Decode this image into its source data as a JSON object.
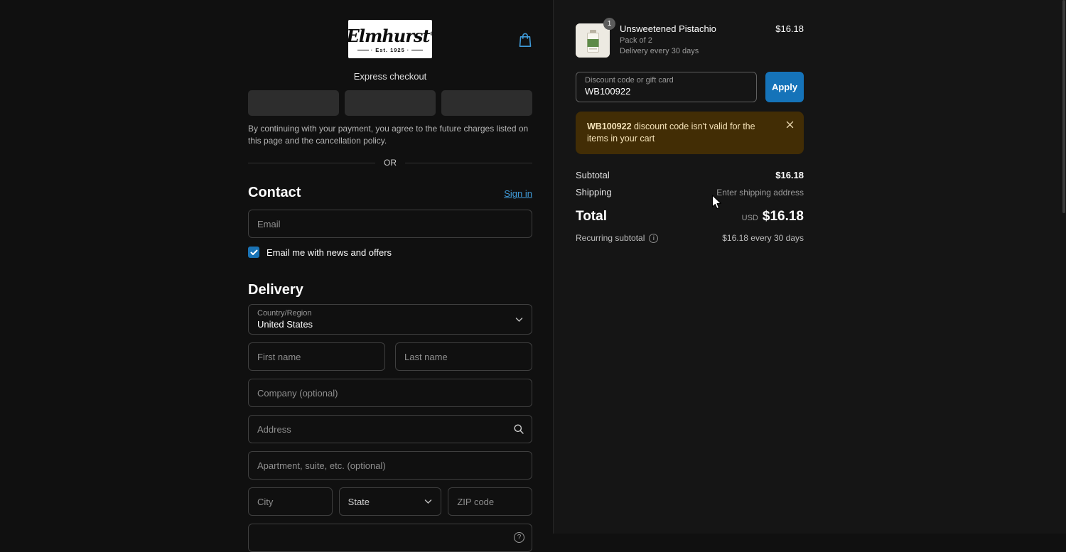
{
  "brand": {
    "name": "Elmhurst",
    "trademark": "®",
    "established": "Est. 1925",
    "dot": "·"
  },
  "express": {
    "title": "Express checkout",
    "disclaimer": "By continuing with your payment, you agree to the future charges listed on this page and the cancellation policy.",
    "or_label": "OR"
  },
  "contact": {
    "heading": "Contact",
    "sign_in_label": "Sign in",
    "email_placeholder": "Email",
    "newsletter_label": "Email me with news and offers",
    "newsletter_checked": true
  },
  "delivery": {
    "heading": "Delivery",
    "country_label": "Country/Region",
    "country_value": "United States",
    "first_name_placeholder": "First name",
    "last_name_placeholder": "Last name",
    "company_placeholder": "Company (optional)",
    "address_placeholder": "Address",
    "apartment_placeholder": "Apartment, suite, etc. (optional)",
    "city_placeholder": "City",
    "state_placeholder": "State",
    "zip_placeholder": "ZIP code"
  },
  "summary": {
    "product": {
      "name": "Unsweetened Pistachio",
      "variant": "Pack of 2",
      "frequency": "Delivery every 30 days",
      "price": "$16.18",
      "quantity": "1"
    },
    "discount": {
      "label": "Discount code or gift card",
      "value": "WB100922",
      "apply_label": "Apply"
    },
    "error": {
      "code": "WB100922",
      "message": "discount code isn't valid for the items in your cart"
    },
    "totals": {
      "subtotal_label": "Subtotal",
      "subtotal_value": "$16.18",
      "shipping_label": "Shipping",
      "shipping_value": "Enter shipping address",
      "total_label": "Total",
      "currency": "USD",
      "total_value": "$16.18",
      "recurring_label": "Recurring subtotal",
      "recurring_value": "$16.18 every 30 days"
    }
  },
  "icons": {
    "question_mark": "?",
    "info": "i"
  },
  "colors": {
    "accent_blue": "#1573b9",
    "link_blue": "#3f9ad8",
    "checkbox_blue": "#1a73b5",
    "error_bg": "#422d05",
    "error_text": "#f4e2b8"
  }
}
